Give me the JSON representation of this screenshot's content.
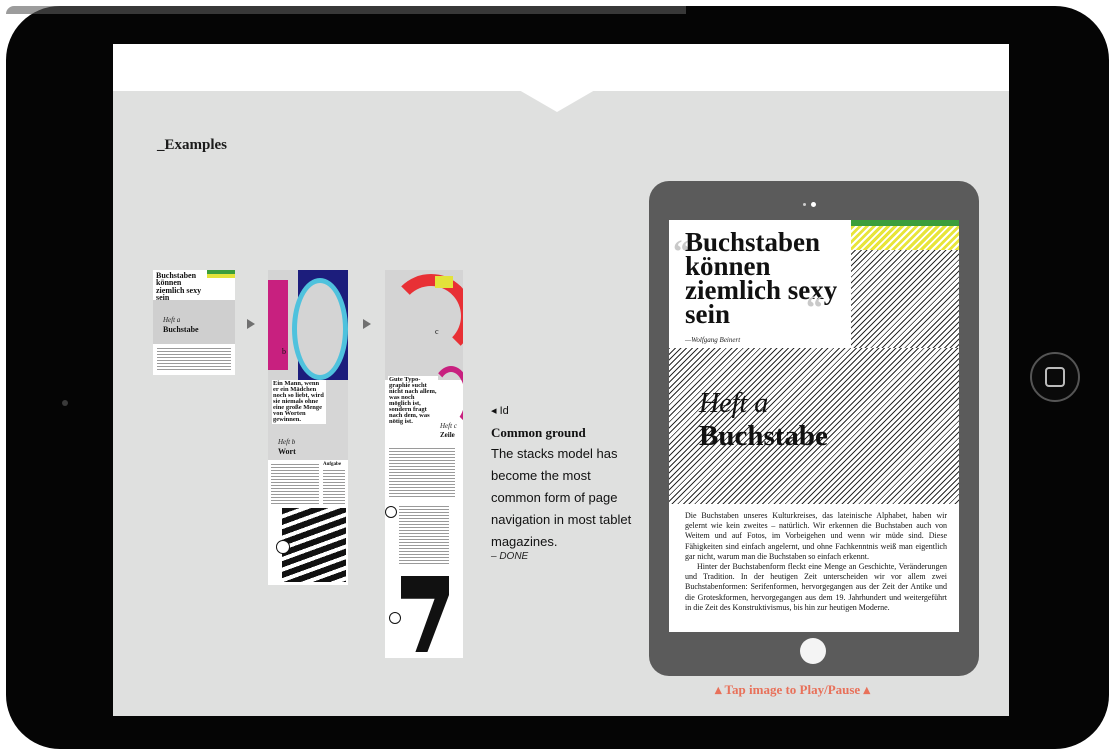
{
  "section": {
    "title": "_Examples"
  },
  "thumbnails": {
    "t1": {
      "headline": "Buchstaben können ziemlich sexy sein",
      "heft": "Heft a",
      "name": "Buchstabe"
    },
    "t2": {
      "glyph": "b",
      "headline": "Ein Mann, wenn er ein Mädchen noch so liebt, wird sie niemals ohne eine große Menge von Worten gewinnen.",
      "heft": "Heft b",
      "name": "Wort",
      "side_label": "Aufgabe"
    },
    "t3": {
      "glyph": "c",
      "headline": "Gute Typo-graphie sucht nicht nach allem, was noch möglich ist, sondern fragt nach dem, was nötig ist.",
      "heft": "Heft c",
      "name": "Zeile"
    }
  },
  "description": {
    "icon_label": "◂ Id",
    "title": "Common ground",
    "body": "The stacks model has become the most common form of page navigation in most tablet magazines.",
    "done": "– DONE"
  },
  "tablet_page": {
    "headline": "Buchstaben können ziemlich sexy sein",
    "attribution": "—Wolfgang Beinert",
    "heft": "Heft a",
    "title": "Buchstabe",
    "body_p1": "Die Buchstaben unseres Kulturkreises, das lateinische Alphabet, haben wir gelernt wie kein zweites – natürlich. Wir erkennen die Buchstaben auch von Weitem und auf Fotos, im Vorbeigehen und wenn wir müde sind. Diese Fähigkeiten sind einfach angelernt, und ohne Fachkenntnis weiß man eigentlich gar nicht, warum man die Buchstaben so einfach erkennt.",
    "body_p2": "Hinter der Buchstabenform fleckt eine Menge an Geschichte, Veränderungen und Tradition. In der heutigen Zeit unterscheiden wir vor allem zwei Buchstabenformen: Serifenformen, hervorgegangen aus der Zeit der Antike und die Groteskformen, hervorgegangen aus dem 19. Jahrhundert und weitergeführt in die Zeit des Konstruktivismus, bis hin zur heutigen Moderne."
  },
  "cta": {
    "label": "▴ Tap image to Play/Pause ▴"
  },
  "colors": {
    "accent": "#e8715a",
    "background": "#dfe0df",
    "tablet": "#5b5b5b"
  }
}
